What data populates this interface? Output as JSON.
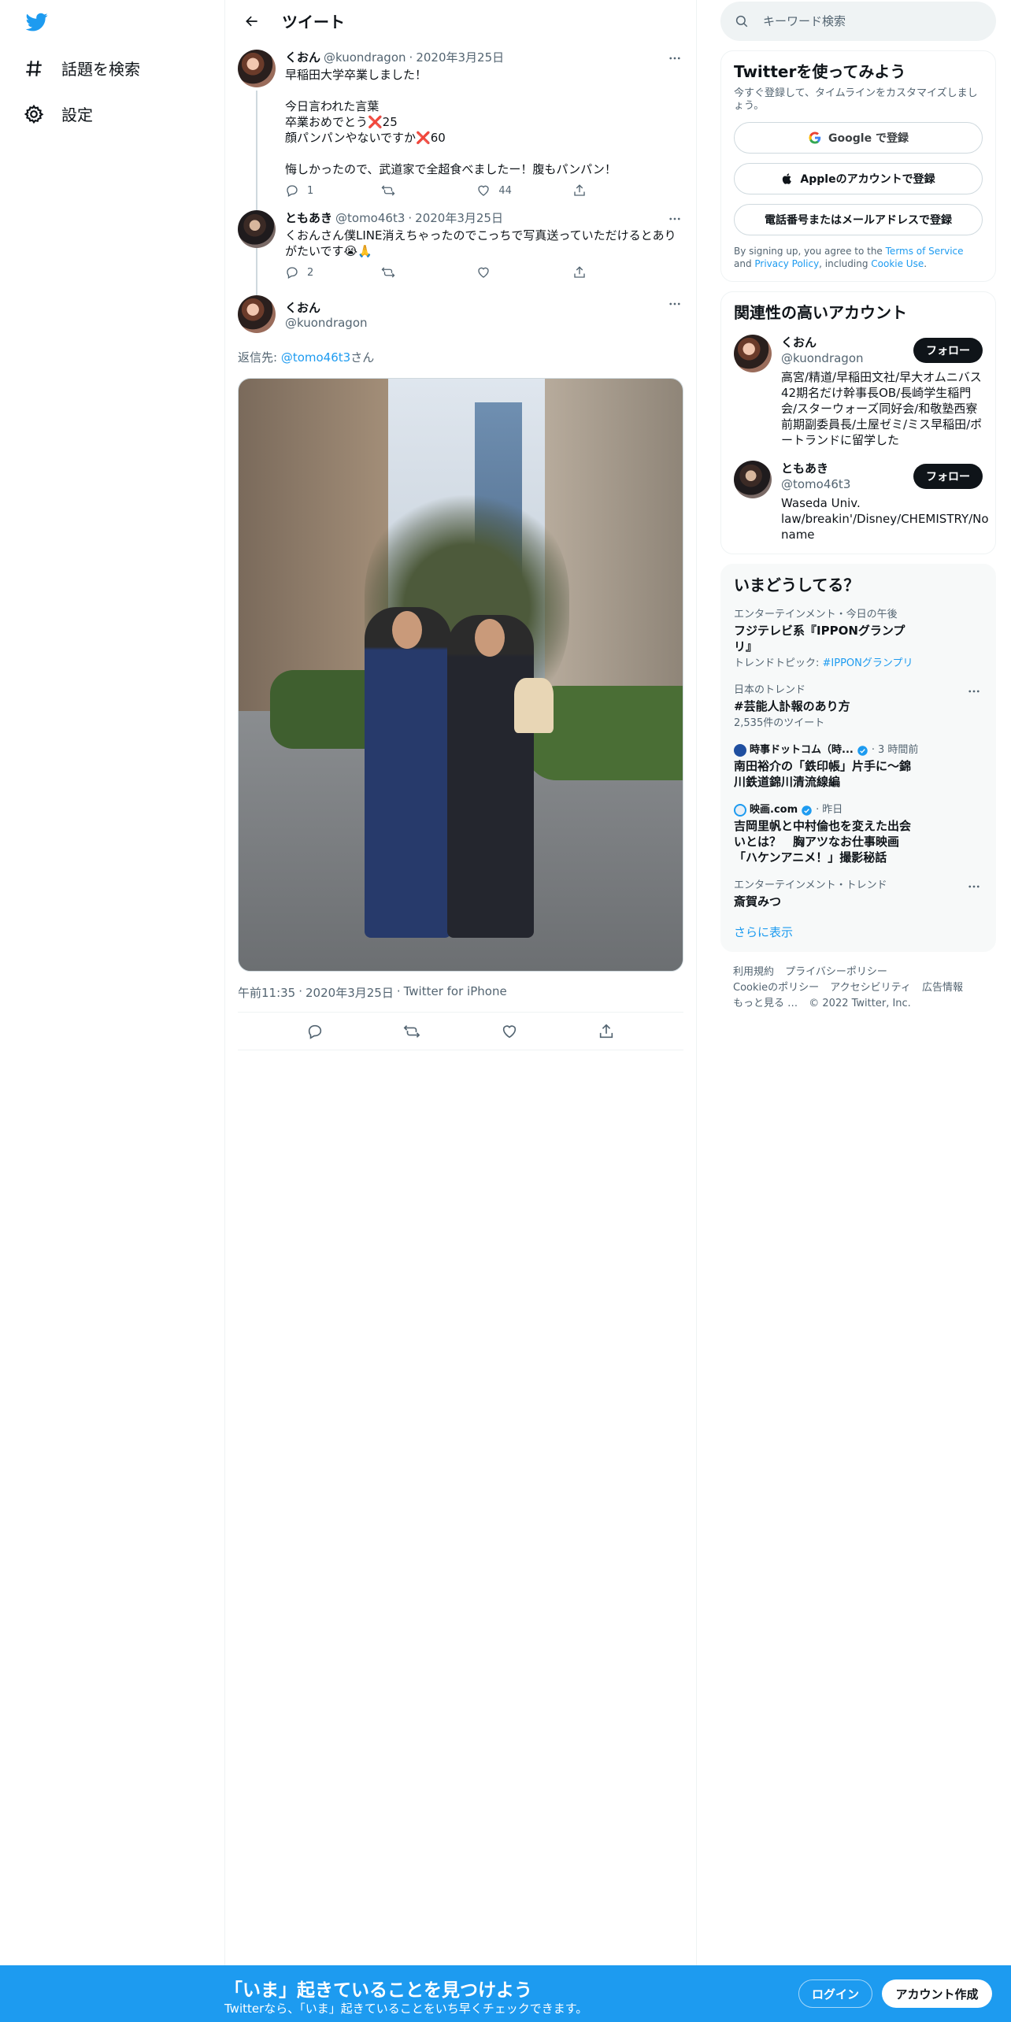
{
  "nav": {
    "logo_icon": "twitter-bird-icon",
    "items": [
      {
        "label": "話題を検索",
        "icon": "hashtag-icon"
      },
      {
        "label": "設定",
        "icon": "gear-icon"
      }
    ]
  },
  "header": {
    "title": "ツイート",
    "back_icon": "back-arrow-icon"
  },
  "thread": [
    {
      "name": "くおん",
      "handle": "@kuondragon",
      "date": "2020年3月25日",
      "text": "早稲田大学卒業しました！\n\n今日言われた言葉\n卒業おめでとう❌25\n顔パンパンやないですか❌60\n\n悔しかったので、武道家で全超食べましたー！腹もパンパン！",
      "replies": "1",
      "retweets": "",
      "likes": "44"
    },
    {
      "name": "ともあき",
      "handle": "@tomo46t3",
      "date": "2020年3月25日",
      "text": "くおんさん僕LINE消えちゃったのでこっちで写真送っていただけるとありがたいです😭🙏",
      "replies": "2",
      "retweets": "",
      "likes": ""
    }
  ],
  "main_tweet": {
    "name": "くおん",
    "handle": "@kuondragon",
    "reply_prefix": "返信先: ",
    "reply_to": "@tomo46t3",
    "reply_suffix": "さん",
    "time": "午前11:35",
    "date": "2020年3月25日",
    "source": "Twitter for iPhone",
    "dot": "·"
  },
  "search": {
    "placeholder": "キーワード検索"
  },
  "signup_card": {
    "title": "Twitterを使ってみよう",
    "subtitle": "今すぐ登録して、タイムラインをカスタマイズしましょう。",
    "google_btn": "Google で登録",
    "apple_btn": "Appleのアカウントで登録",
    "phone_btn": "電話番号またはメールアドレスで登録",
    "legal_prefix": "By signing up, you agree to the ",
    "terms": "Terms of Service",
    "and": " and ",
    "privacy": "Privacy Policy",
    "including": ", including ",
    "cookie": "Cookie Use",
    "end": "."
  },
  "relevant": {
    "title": "関連性の高いアカウント",
    "follow_label": "フォロー",
    "accounts": [
      {
        "name": "くおん",
        "handle": "@kuondragon",
        "bio": "高宮/精道/早稲田文社/早大オムニバス42期名だけ幹事長OB/長崎学生稲門会/スターウォーズ同好会/和敬塾西寮前期副委員長/土屋ゼミ/ミス早稲田/ポートランドに留学した"
      },
      {
        "name": "ともあき",
        "handle": "@tomo46t3",
        "bio": "Waseda Univ. law/breakin'/Disney/CHEMISTRY/No name"
      }
    ]
  },
  "trends": {
    "title": "いまどうしてる？",
    "items": [
      {
        "category": "エンターテインメント・今日の午後",
        "name": "フジテレビ系『IPPONグランプリ』",
        "sub_prefix": "トレンドトピック: ",
        "sub_link": "#IPPONグランプリ"
      },
      {
        "category": "日本のトレンド",
        "name": "#芸能人訃報のあり方",
        "sub": "2,535件のツイート"
      },
      {
        "source": "時事ドットコム（時...",
        "time": "3 時間前",
        "name": "南田裕介の「鉄印帳」片手に～錦川鉄道錦川清流線編"
      },
      {
        "source": "映画.com",
        "time": "昨日",
        "name": "吉岡里帆と中村倫也を変えた出会いとは？　胸アツなお仕事映画「ハケンアニメ！」撮影秘話"
      },
      {
        "category": "エンターテインメント・トレンド",
        "name": "斎賀みつ"
      }
    ],
    "show_more": "さらに表示"
  },
  "footer": {
    "links": [
      "利用規約",
      "プライバシーポリシー",
      "Cookieのポリシー",
      "アクセシビリティ",
      "広告情報",
      "もっと見る …"
    ],
    "copyright": "© 2022 Twitter, Inc."
  },
  "banner": {
    "title": "「いま」起きていることを見つけよう",
    "subtitle": "Twitterなら、「いま」起きていることをいち早くチェックできます。",
    "login": "ログイン",
    "signup": "アカウント作成"
  },
  "colors": {
    "accent": "#1d9bf0",
    "text": "#0f1419",
    "muted": "#536471",
    "border": "#eff3f4"
  }
}
